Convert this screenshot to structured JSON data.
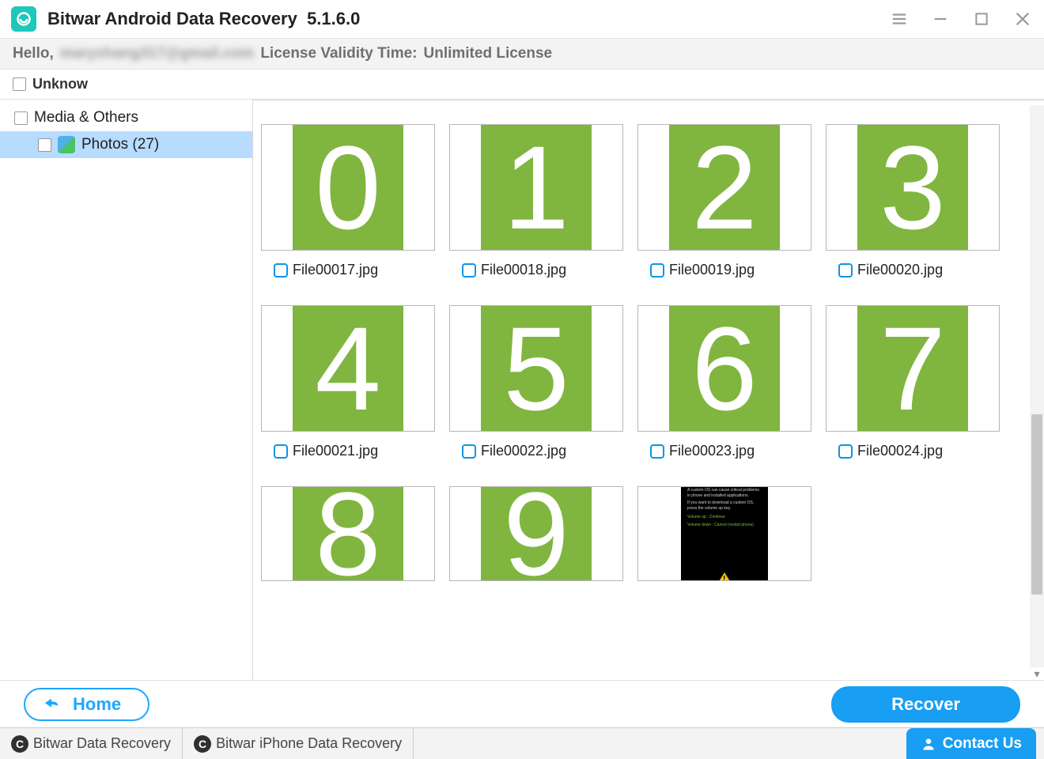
{
  "titlebar": {
    "app_name": "Bitwar Android Data Recovery",
    "version": "5.1.6.0"
  },
  "license": {
    "greeting": "Hello,",
    "email_masked": "maryshang317@gmail.com",
    "license_label": "License Validity Time:",
    "license_value": "Unlimited License"
  },
  "unknow_label": "Unknow",
  "sidebar": {
    "category_label": "Media & Others",
    "photos_label": "Photos (27)"
  },
  "files": [
    {
      "digit": "0",
      "name": "File00017.jpg",
      "kind": "digit"
    },
    {
      "digit": "1",
      "name": "File00018.jpg",
      "kind": "digit"
    },
    {
      "digit": "2",
      "name": "File00019.jpg",
      "kind": "digit"
    },
    {
      "digit": "3",
      "name": "File00020.jpg",
      "kind": "digit"
    },
    {
      "digit": "4",
      "name": "File00021.jpg",
      "kind": "digit"
    },
    {
      "digit": "5",
      "name": "File00022.jpg",
      "kind": "digit"
    },
    {
      "digit": "6",
      "name": "File00023.jpg",
      "kind": "digit"
    },
    {
      "digit": "7",
      "name": "File00024.jpg",
      "kind": "digit"
    },
    {
      "digit": "8",
      "name": "",
      "kind": "digit"
    },
    {
      "digit": "9",
      "name": "",
      "kind": "digit"
    },
    {
      "digit": "",
      "name": "",
      "kind": "warn"
    }
  ],
  "actions": {
    "home": "Home",
    "recover": "Recover"
  },
  "linkbar": {
    "link1": "Bitwar Data Recovery",
    "link2": "Bitwar iPhone Data Recovery",
    "contact": "Contact Us"
  }
}
